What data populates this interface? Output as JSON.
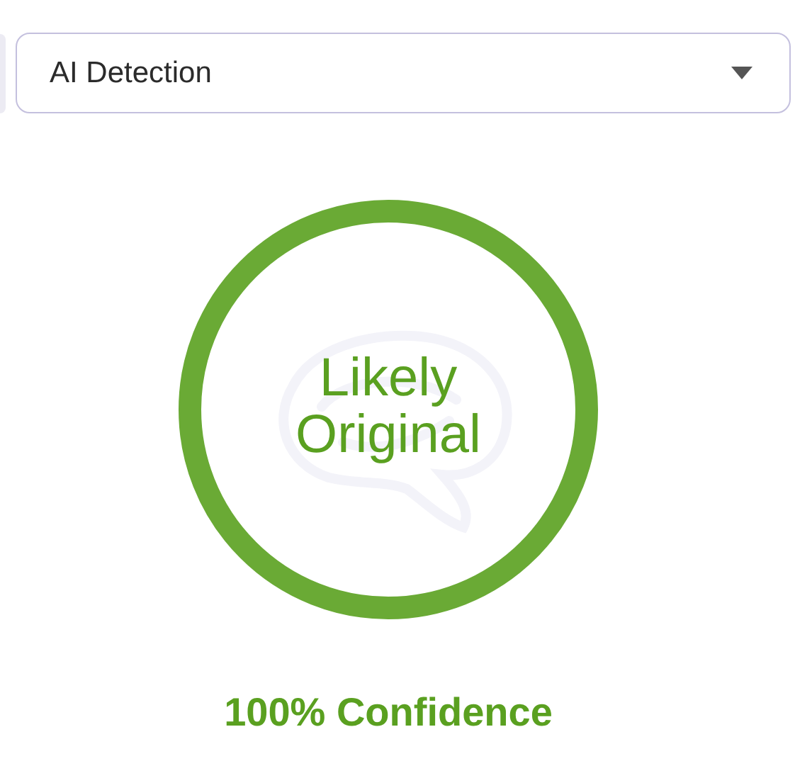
{
  "mode_select": {
    "value": "AI Detection"
  },
  "result": {
    "verdict": "Likely Original",
    "confidence": "100% Confidence"
  }
}
